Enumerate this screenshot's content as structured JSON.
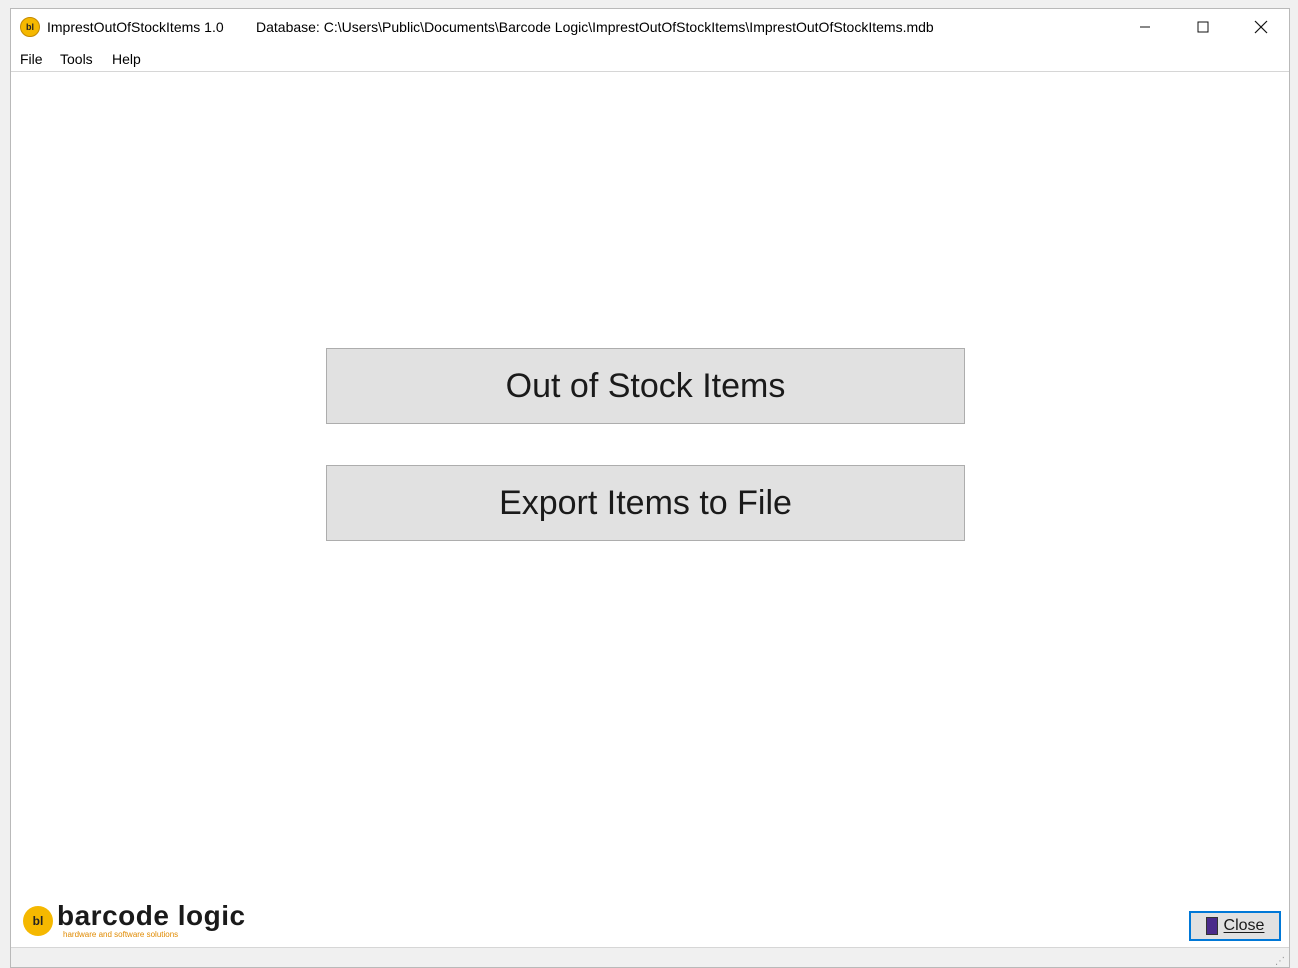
{
  "window": {
    "app_icon_text": "bl",
    "title": "ImprestOutOfStockItems 1.0",
    "database_label": "Database: C:\\Users\\Public\\Documents\\Barcode Logic\\ImprestOutOfStockItems\\ImprestOutOfStockItems.mdb"
  },
  "controls": {
    "minimize_icon": "minimize-icon",
    "maximize_icon": "maximize-icon",
    "close_icon": "close-icon"
  },
  "menu": {
    "items": [
      {
        "label": "File"
      },
      {
        "label": "Tools"
      },
      {
        "label": "Help"
      }
    ]
  },
  "main": {
    "out_of_stock_label": "Out of Stock Items",
    "export_label": "Export Items to File"
  },
  "footer": {
    "logo_mark": "bl",
    "logo_word": "barcode logic",
    "logo_tagline": "hardware and software solutions",
    "close_label": "Close"
  },
  "colors": {
    "accent": "#0078d7",
    "logo_yellow": "#f5b800",
    "button_face": "#e1e1e1"
  }
}
